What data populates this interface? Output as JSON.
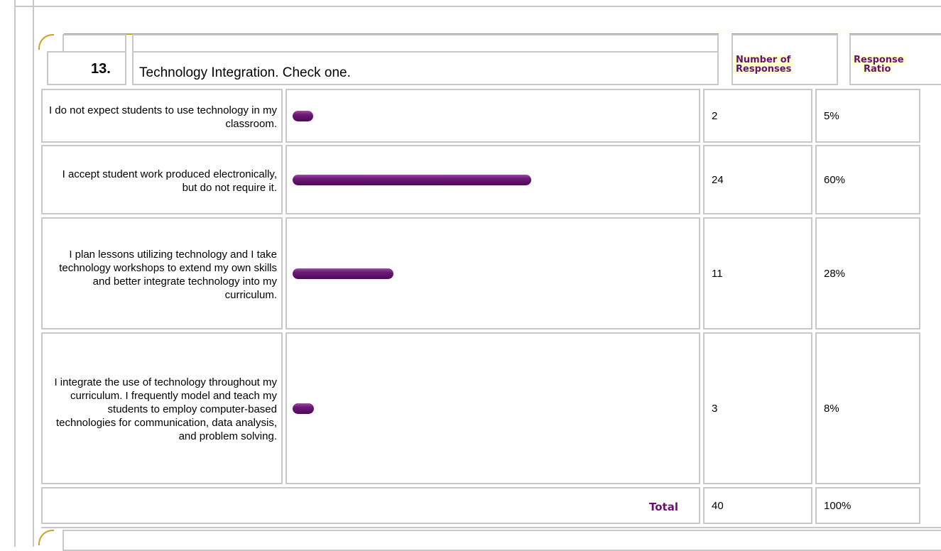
{
  "question": {
    "number": "13.",
    "text": "Technology Integration. Check one."
  },
  "headers": {
    "responses": [
      "Number of",
      "Responses"
    ],
    "ratio": [
      "Response",
      "Ratio"
    ]
  },
  "rows": [
    {
      "label": "I do not expect students to use technology in my classroom.",
      "count": "2",
      "ratio": "5%"
    },
    {
      "label": "I accept student work produced electronically, but do not require it.",
      "count": "24",
      "ratio": "60%"
    },
    {
      "label": "I plan lessons utilizing technology and I take technology workshops to extend my own skills and better integrate technology into my curriculum.",
      "count": "11",
      "ratio": "28%"
    },
    {
      "label": "I integrate the use of technology throughout my curriculum. I frequently model and teach my students to employ computer-based technologies for communication, data analysis, and problem solving.",
      "count": "3",
      "ratio": "8%"
    }
  ],
  "total": {
    "label": "Total",
    "count": "40",
    "ratio": "100%"
  },
  "chart_data": {
    "type": "bar",
    "categories": [
      "I do not expect students to use technology in my classroom.",
      "I accept student work produced electronically, but do not require it.",
      "I plan lessons utilizing technology and I take technology workshops to extend my own skills and better integrate technology into my curriculum.",
      "I integrate the use of technology throughout my curriculum. I frequently model and teach my students to employ computer-based technologies for communication, data analysis, and problem solving."
    ],
    "values": [
      5,
      60,
      28,
      8
    ],
    "xlim": [
      0,
      100
    ],
    "color": "#5e1068"
  }
}
